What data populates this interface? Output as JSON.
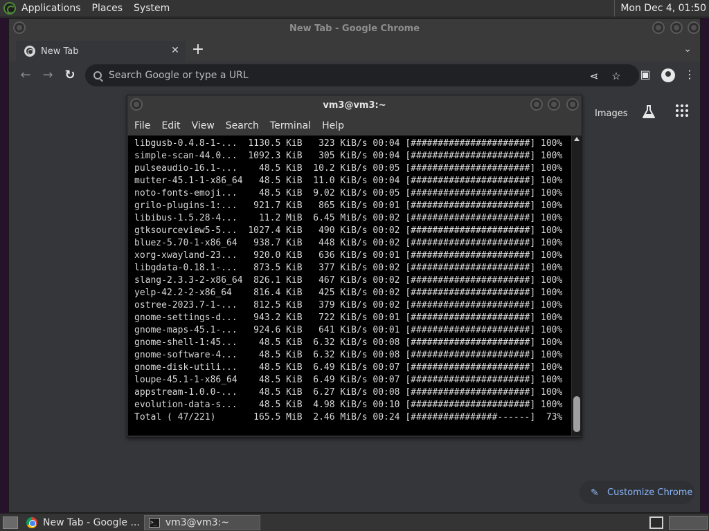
{
  "top_panel": {
    "menus": [
      "Applications",
      "Places",
      "System"
    ],
    "clock": "Mon Dec  4, 01:50"
  },
  "chrome": {
    "window_title": "New Tab - Google Chrome",
    "tab_title": "New Tab",
    "omnibox_placeholder": "Search Google or type a URL",
    "page_links": {
      "images": "Images"
    },
    "customize_label": "Customize Chrome"
  },
  "terminal": {
    "title": "vm3@vm3:~",
    "menus": [
      "File",
      "Edit",
      "View",
      "Search",
      "Terminal",
      "Help"
    ],
    "lines": [
      "libgusb-0.4.8-1-...  1130.5 KiB   323 KiB/s 00:04 [######################] 100%",
      "simple-scan-44.0...  1092.3 KiB   305 KiB/s 00:04 [######################] 100%",
      "pulseaudio-16.1-...    48.5 KiB  10.2 KiB/s 00:05 [######################] 100%",
      "mutter-45.1-1-x86_64   48.5 KiB  11.0 KiB/s 00:04 [######################] 100%",
      "noto-fonts-emoji...    48.5 KiB  9.02 KiB/s 00:05 [######################] 100%",
      "grilo-plugins-1:...   921.7 KiB   865 KiB/s 00:01 [######################] 100%",
      "libibus-1.5.28-4...    11.2 MiB  6.45 MiB/s 00:02 [######################] 100%",
      "gtksourceview5-5...  1027.4 KiB   490 KiB/s 00:02 [######################] 100%",
      "bluez-5.70-1-x86_64   938.7 KiB   448 KiB/s 00:02 [######################] 100%",
      "xorg-xwayland-23...   920.0 KiB   636 KiB/s 00:01 [######################] 100%",
      "libgdata-0.18.1-...   873.5 KiB   377 KiB/s 00:02 [######################] 100%",
      "slang-2.3.3-2-x86_64  826.1 KiB   467 KiB/s 00:02 [######################] 100%",
      "yelp-42.2-2-x86_64    816.4 KiB   425 KiB/s 00:02 [######################] 100%",
      "ostree-2023.7-1-...   812.5 KiB   379 KiB/s 00:02 [######################] 100%",
      "gnome-settings-d...   943.2 KiB   722 KiB/s 00:01 [######################] 100%",
      "gnome-maps-45.1-...   924.6 KiB   641 KiB/s 00:01 [######################] 100%",
      "gnome-shell-1:45...    48.5 KiB  6.32 KiB/s 00:08 [######################] 100%",
      "gnome-software-4...    48.5 KiB  6.32 KiB/s 00:08 [######################] 100%",
      "gnome-disk-utili...    48.5 KiB  6.49 KiB/s 00:07 [######################] 100%",
      "loupe-45.1-1-x86_64    48.5 KiB  6.49 KiB/s 00:07 [######################] 100%",
      "appstream-1.0.0-...    48.5 KiB  6.27 KiB/s 00:08 [######################] 100%",
      "evolution-data-s...    48.5 KiB  4.98 KiB/s 00:10 [######################] 100%",
      "Total ( 47/221)       165.5 MiB  2.46 MiB/s 00:24 [################------]  73%"
    ]
  },
  "taskbar": {
    "items": [
      "New Tab - Google ...",
      "vm3@vm3:~"
    ]
  },
  "colors": {
    "accent_blue": "#8ab4f8",
    "terminal_bg": "#000000",
    "desktop_edge": "#26122a"
  },
  "icons": {
    "omnibox": "search-icon",
    "share": "share-icon",
    "bookmark": "star-icon",
    "sidebar": "side-panel-icon",
    "profile": "profile-icon",
    "menu": "kebab-menu-icon",
    "labs": "flask-icon",
    "apps": "apps-grid-icon",
    "customize": "pencil-icon"
  }
}
